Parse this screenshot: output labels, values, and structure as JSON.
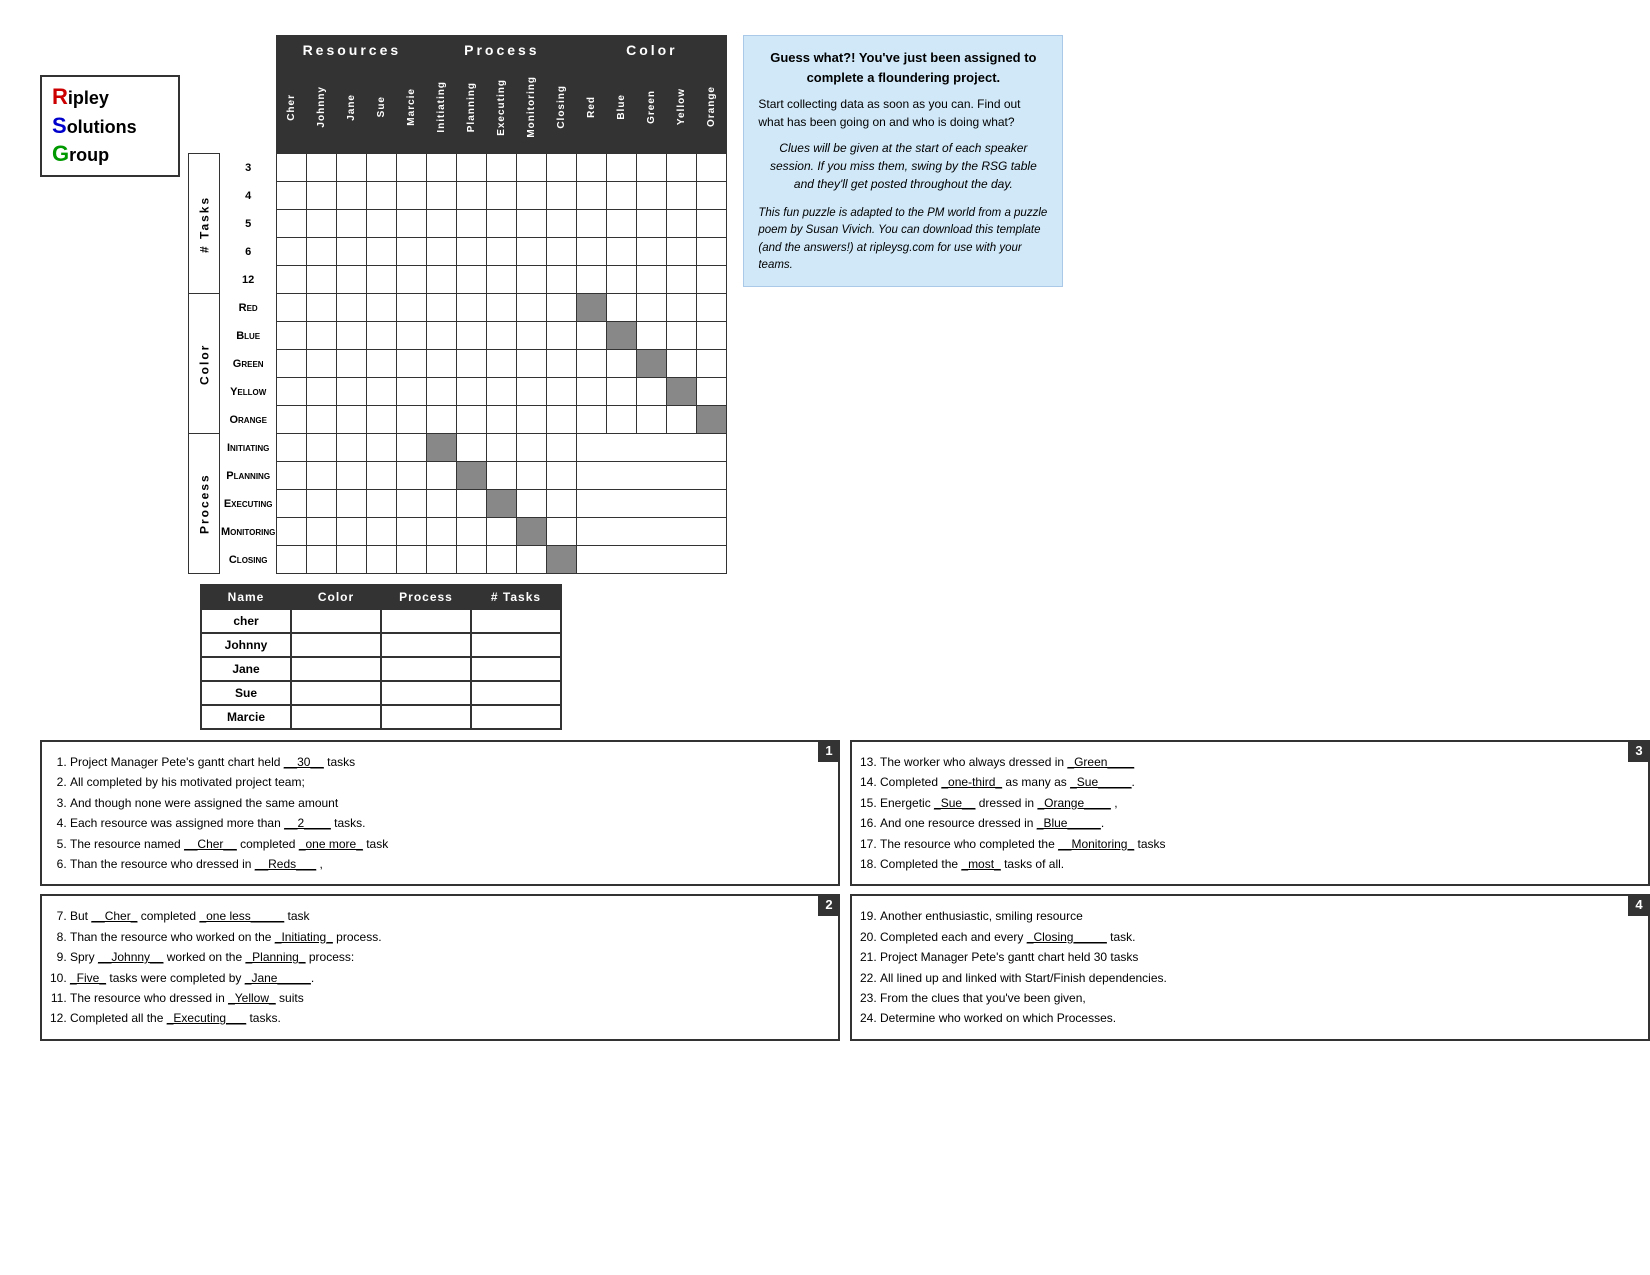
{
  "logo": {
    "line1": "ipley",
    "line2": "olutions",
    "line3": "roup",
    "r": "R",
    "s": "S",
    "g": "G"
  },
  "headers": {
    "resources": "Resources",
    "process": "Process",
    "color": "Color"
  },
  "columns": {
    "resources": [
      "Cher",
      "Johnny",
      "Jane",
      "Sue",
      "Marcie"
    ],
    "process": [
      "Initiating",
      "Planning",
      "Executing",
      "Monitoring",
      "Closing"
    ],
    "color": [
      "Red",
      "Blue",
      "Green",
      "Yellow",
      "Orange"
    ]
  },
  "rowGroups": {
    "tasks": {
      "label": "# Tasks",
      "rows": [
        "3",
        "4",
        "5",
        "6",
        "12"
      ]
    },
    "color": {
      "label": "Color",
      "rows": [
        "Red",
        "Blue",
        "Green",
        "Yellow",
        "Orange"
      ]
    },
    "process": {
      "label": "Process",
      "rows": [
        "Initiating",
        "Planning",
        "Executing",
        "Monitoring",
        "Closing"
      ]
    }
  },
  "infoBox": {
    "title": "Guess what?! You've just been assigned to complete a floundering project.",
    "body": "Start collecting data as soon as you can.  Find out what has been going on and who is doing what?",
    "italic1": "Clues will be given at the start of each speaker session.  If you miss them, swing by the RSG table and they'll get posted throughout the day.",
    "italic2": "This fun puzzle is adapted to the PM world from a puzzle poem by Susan Vivich.  You can download this template (and the answers!) at ripleysg.com for use with your teams."
  },
  "answerTable": {
    "headers": [
      "Name",
      "Color",
      "Process",
      "# Tasks"
    ],
    "rows": [
      {
        "name": "Cher"
      },
      {
        "name": "Johnny"
      },
      {
        "name": "Jane"
      },
      {
        "name": "Sue"
      },
      {
        "name": "Marcie"
      }
    ]
  },
  "clues": {
    "box1": {
      "number": "1",
      "items": [
        "1.  Project Manager Pete's gantt chart held <u>__30__</u> tasks",
        "2.  All completed by his motivated project team;",
        "3.  And though none were assigned the same amount",
        "4.  Each resource was assigned more than <u>__2____</u> tasks.",
        "5.  The resource named <u>__Cher__</u> completed <u>_one more_</u> task",
        "6.  Than the resource who dressed in <u>__Reds___</u> ,"
      ]
    },
    "box2": {
      "number": "2",
      "items": [
        "7.  But <u>__Cher_</u> completed <u>_one less_____</u> task",
        "8.  Than the resource who worked on the <u>_Initiating_</u> process.",
        "9.  Spry <u>__Johnny__</u> worked on the <u>_Planning_</u> process:",
        "10. <u>_Five_</u> tasks were completed by <u>_Jane_____</u>.",
        "11. The resource who dressed in <u>_Yellow_</u> suits",
        "12. Completed all the <u>_Executing___</u> tasks."
      ]
    },
    "box3": {
      "number": "3",
      "items": [
        "13. The worker who always dressed in <u>_Green____</u>",
        "14. Completed <u>_one-third_</u> as many as <u>_Sue_____</u>.",
        "15. Energetic <u>_Sue__</u> dressed in <u>_Orange____</u> ,",
        "16. And one resource dressed in <u>_Blue_____</u>.",
        "17. The resource who completed the <u>__Monitoring_</u> tasks",
        "18. Completed the <u>_most_</u> tasks of all."
      ]
    },
    "box4": {
      "number": "4",
      "items": [
        "19. Another enthusiastic, smiling resource",
        "20. Completed each and every <u>_Closing_____</u> task.",
        "21. Project Manager Pete's gantt chart held 30 tasks",
        "22. All lined up and linked with Start/Finish dependencies.",
        "23. From the clues that you've been given,",
        "24. Determine who worked on which Processes."
      ]
    }
  }
}
